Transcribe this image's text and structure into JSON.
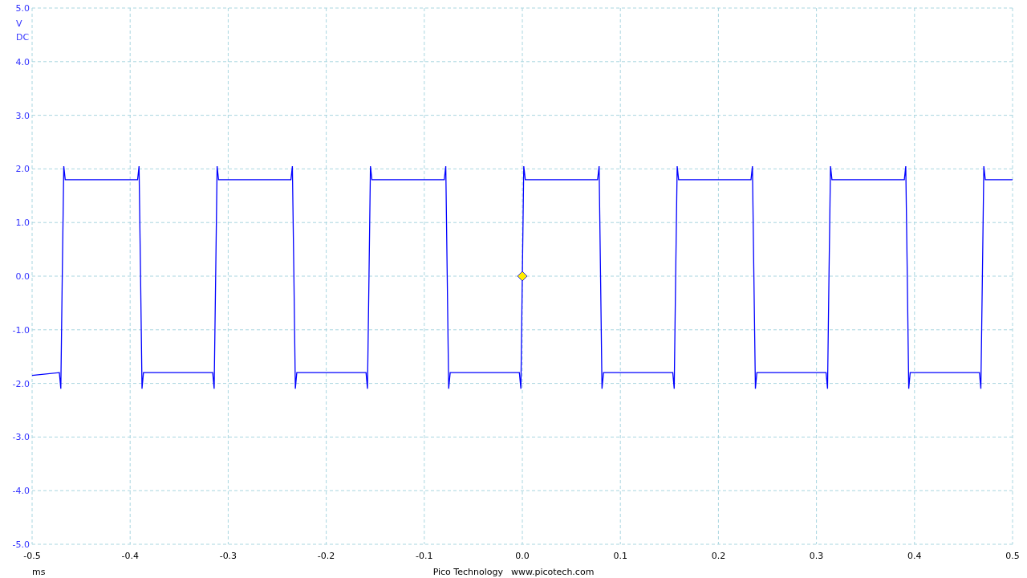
{
  "scope": {
    "coupling": "DC",
    "chart_data": {
      "type": "line",
      "xlabel": "ms",
      "ylabel": "V",
      "xlim": [
        -0.5,
        0.5
      ],
      "ylim": [
        -5,
        5
      ],
      "xticks": [
        {
          "value": -0.5,
          "label": "-0.5"
        },
        {
          "value": -0.4,
          "label": "-0.4"
        },
        {
          "value": -0.3,
          "label": "-0.3"
        },
        {
          "value": -0.2,
          "label": "-0.2"
        },
        {
          "value": -0.1,
          "label": "-0.1"
        },
        {
          "value": 0,
          "label": "0.0"
        },
        {
          "value": 0.1,
          "label": "0.1"
        },
        {
          "value": 0.2,
          "label": "0.2"
        },
        {
          "value": 0.3,
          "label": "0.3"
        },
        {
          "value": 0.4,
          "label": "0.4"
        },
        {
          "value": 0.5,
          "label": "0.5"
        }
      ],
      "yticks": [
        {
          "value": 5,
          "label": "5.0"
        },
        {
          "value": 4,
          "label": "4.0"
        },
        {
          "value": 3,
          "label": "3.0"
        },
        {
          "value": 2,
          "label": "2.0"
        },
        {
          "value": 1,
          "label": "1.0"
        },
        {
          "value": 0,
          "label": "0.0"
        },
        {
          "value": -1,
          "label": "-1.0"
        },
        {
          "value": -2,
          "label": "-2.0"
        },
        {
          "value": -3,
          "label": "-3.0"
        },
        {
          "value": -4,
          "label": "-4.0"
        },
        {
          "value": -5,
          "label": "-5.0"
        }
      ],
      "x": [
        -0.5,
        -0.4722,
        -0.4707,
        -0.4692,
        -0.4677,
        -0.4662,
        -0.3924,
        -0.3909,
        -0.3894,
        -0.3879,
        -0.3864,
        -0.3158,
        -0.3143,
        -0.3128,
        -0.3113,
        -0.3098,
        -0.236,
        -0.2345,
        -0.233,
        -0.2315,
        -0.23,
        -0.1594,
        -0.1579,
        -0.1564,
        -0.1549,
        -0.1534,
        -0.0796,
        -0.0781,
        -0.0766,
        -0.0751,
        -0.0736,
        -0.003,
        -0.0015,
        0,
        0.0015,
        0.003,
        0.0768,
        0.0783,
        0.0798,
        0.0813,
        0.0828,
        0.1534,
        0.1549,
        0.1564,
        0.1579,
        0.1594,
        0.2332,
        0.2347,
        0.2362,
        0.2377,
        0.2392,
        0.3098,
        0.3113,
        0.3128,
        0.3143,
        0.3158,
        0.3896,
        0.3911,
        0.3926,
        0.3941,
        0.3956,
        0.4662,
        0.4677,
        0.4692,
        0.4707,
        0.4722,
        0.5
      ],
      "series": [
        {
          "color": "#0000ff",
          "values": [
            -1.85,
            -1.8,
            -2.1,
            0,
            2.05,
            1.8,
            1.8,
            2.05,
            0,
            -2.1,
            -1.8,
            -1.8,
            -2.1,
            0,
            2.05,
            1.8,
            1.8,
            2.05,
            0,
            -2.1,
            -1.8,
            -1.8,
            -2.1,
            0,
            2.05,
            1.8,
            1.8,
            2.05,
            0,
            -2.1,
            -1.8,
            -1.8,
            -2.1,
            0,
            2.05,
            1.8,
            1.8,
            2.05,
            0,
            -2.1,
            -1.8,
            -1.8,
            -2.1,
            0,
            2.05,
            1.8,
            1.8,
            2.05,
            0,
            -2.1,
            -1.8,
            -1.8,
            -2.1,
            0,
            2.05,
            1.8,
            1.8,
            2.05,
            0,
            -2.1,
            -1.8,
            -1.8,
            -2.1,
            0,
            2.05,
            1.8,
            1.8
          ]
        }
      ],
      "grid": true
    },
    "trigger_marker": {
      "on": true
    }
  },
  "footer": {
    "company": "Pico Technology",
    "website": "www.picotech.com"
  }
}
